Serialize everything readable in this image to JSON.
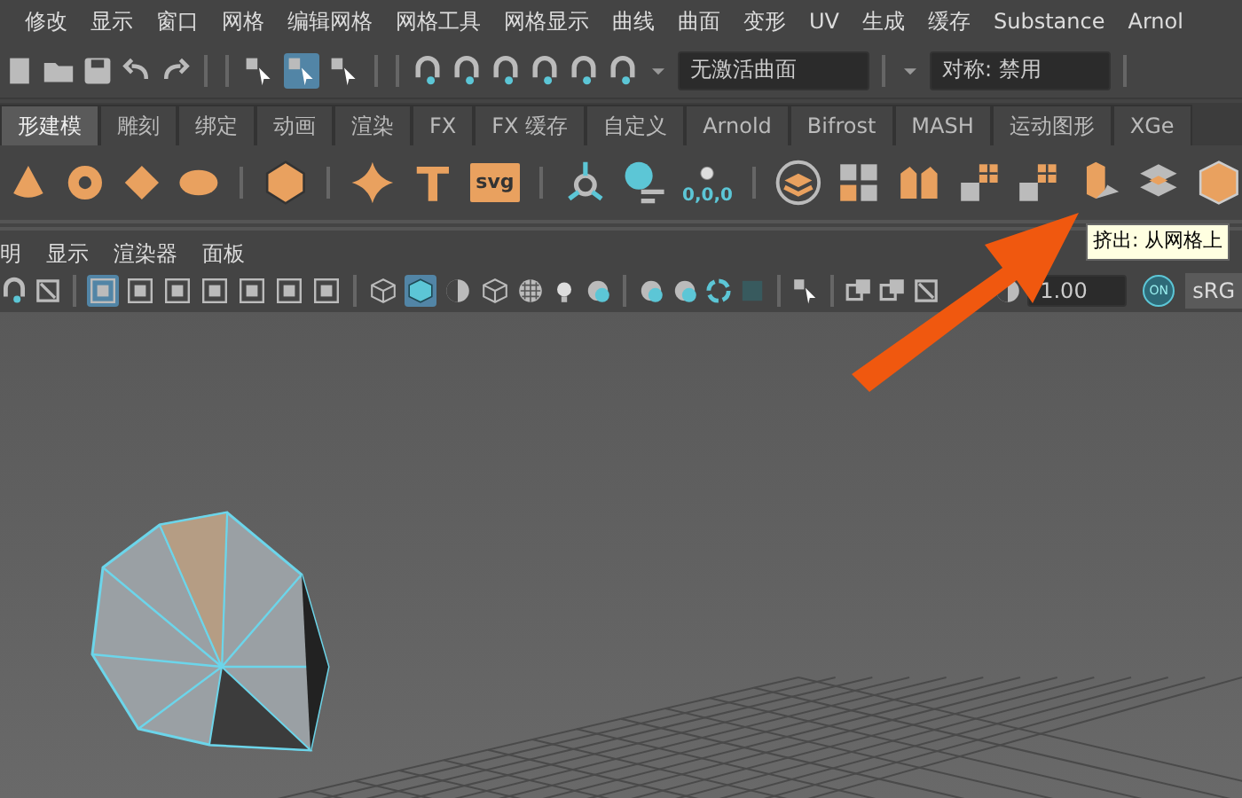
{
  "menu_bar": [
    "修改",
    "显示",
    "窗口",
    "网格",
    "编辑网格",
    "网格工具",
    "网格显示",
    "曲线",
    "曲面",
    "变形",
    "UV",
    "生成",
    "缓存",
    "Substance",
    "Arnol"
  ],
  "status_line": {
    "selection_modes": [
      {
        "selected": false
      },
      {
        "selected": true
      },
      {
        "selected": false
      }
    ],
    "live_surface": "无激活曲面",
    "symmetry": "对称: 禁用"
  },
  "shelf_tabs": [
    {
      "label": "形建模",
      "selected": true
    },
    {
      "label": "雕刻",
      "selected": false
    },
    {
      "label": "绑定",
      "selected": false
    },
    {
      "label": "动画",
      "selected": false
    },
    {
      "label": "渲染",
      "selected": false
    },
    {
      "label": "FX",
      "selected": false
    },
    {
      "label": "FX 缓存",
      "selected": false
    },
    {
      "label": "自定义",
      "selected": false
    },
    {
      "label": "Arnold",
      "selected": false
    },
    {
      "label": "Bifrost",
      "selected": false
    },
    {
      "label": "MASH",
      "selected": false
    },
    {
      "label": "运动图形",
      "selected": false
    },
    {
      "label": "XGe",
      "selected": false
    }
  ],
  "shelf": {
    "svg_label": "svg",
    "freeze_label": "0,0,0"
  },
  "panel_menu": [
    "明",
    "显示",
    "渲染器",
    "面板"
  ],
  "panel_toolbar": {
    "toggles": [
      {
        "selected": true
      },
      {
        "selected": false
      },
      {
        "selected": false
      },
      {
        "selected": false
      },
      {
        "selected": false
      },
      {
        "selected": false
      },
      {
        "selected": false
      }
    ],
    "shading": [
      {
        "selected": false
      },
      {
        "selected": true
      },
      {
        "selected": false
      },
      {
        "selected": false
      }
    ],
    "exposure": "1.00",
    "on_label": "ON",
    "color_space": "sRG"
  },
  "tooltip": "挤出: 从网格上"
}
